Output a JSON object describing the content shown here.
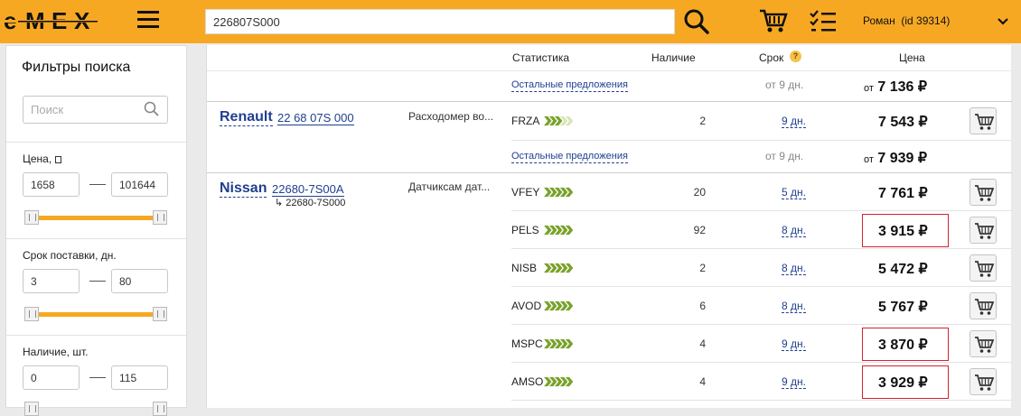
{
  "header": {
    "logo_text": "emex",
    "search_value": "226807S000",
    "user_label": "Роман  (id 39314)",
    "accent_color": "#f7a823"
  },
  "sidebar": {
    "title": "Фильтры поиска",
    "search_placeholder": "Поиск",
    "price": {
      "label": "Цена, ",
      "min": "1658",
      "max": "101644"
    },
    "delivery": {
      "label": "Срок поставки, дн.",
      "min": "3",
      "max": "80"
    },
    "stock": {
      "label": "Наличие, шт.",
      "min": "0",
      "max": "115"
    }
  },
  "table": {
    "columns": {
      "stats": "Статистика",
      "stock": "Наличие",
      "term": "Срок",
      "price": "Цена"
    },
    "term_help": "?",
    "groups": [
      {
        "brand": "",
        "part_number": "",
        "description": "",
        "other": {
          "label": "Остальные предложения",
          "days": "от 9 дн.",
          "from": "от",
          "price": "7 136 ₽"
        }
      },
      {
        "brand": "Renault",
        "part_number": "22 68 07S 000",
        "description": "Расходомер во...",
        "rows": [
          {
            "supplier": "FRZA",
            "qty": "2",
            "days": "9 дн.",
            "price": "7 543 ₽",
            "highlight": false,
            "rating": 3
          }
        ],
        "other": {
          "label": "Остальные предложения",
          "days": "от 9 дн.",
          "from": "от",
          "price": "7 939 ₽"
        }
      },
      {
        "brand": "Nissan",
        "part_number": "22680-7S00A",
        "sub_number": "22680-7S000",
        "description": "Датчиксам дат...",
        "rows": [
          {
            "supplier": "VFEY",
            "qty": "20",
            "days": "5 дн.",
            "price": "7 761 ₽",
            "highlight": false,
            "rating": 5
          },
          {
            "supplier": "PELS",
            "qty": "92",
            "days": "8 дн.",
            "price": "3 915 ₽",
            "highlight": true,
            "rating": 5
          },
          {
            "supplier": "NISB",
            "qty": "2",
            "days": "8 дн.",
            "price": "5 472 ₽",
            "highlight": false,
            "rating": 5
          },
          {
            "supplier": "AVOD",
            "qty": "6",
            "days": "8 дн.",
            "price": "5 767 ₽",
            "highlight": false,
            "rating": 5
          },
          {
            "supplier": "MSPC",
            "qty": "4",
            "days": "9 дн.",
            "price": "3 870 ₽",
            "highlight": true,
            "rating": 5
          },
          {
            "supplier": "AMSO",
            "qty": "4",
            "days": "9 дн.",
            "price": "3 929 ₽",
            "highlight": true,
            "rating": 5
          }
        ]
      }
    ]
  }
}
